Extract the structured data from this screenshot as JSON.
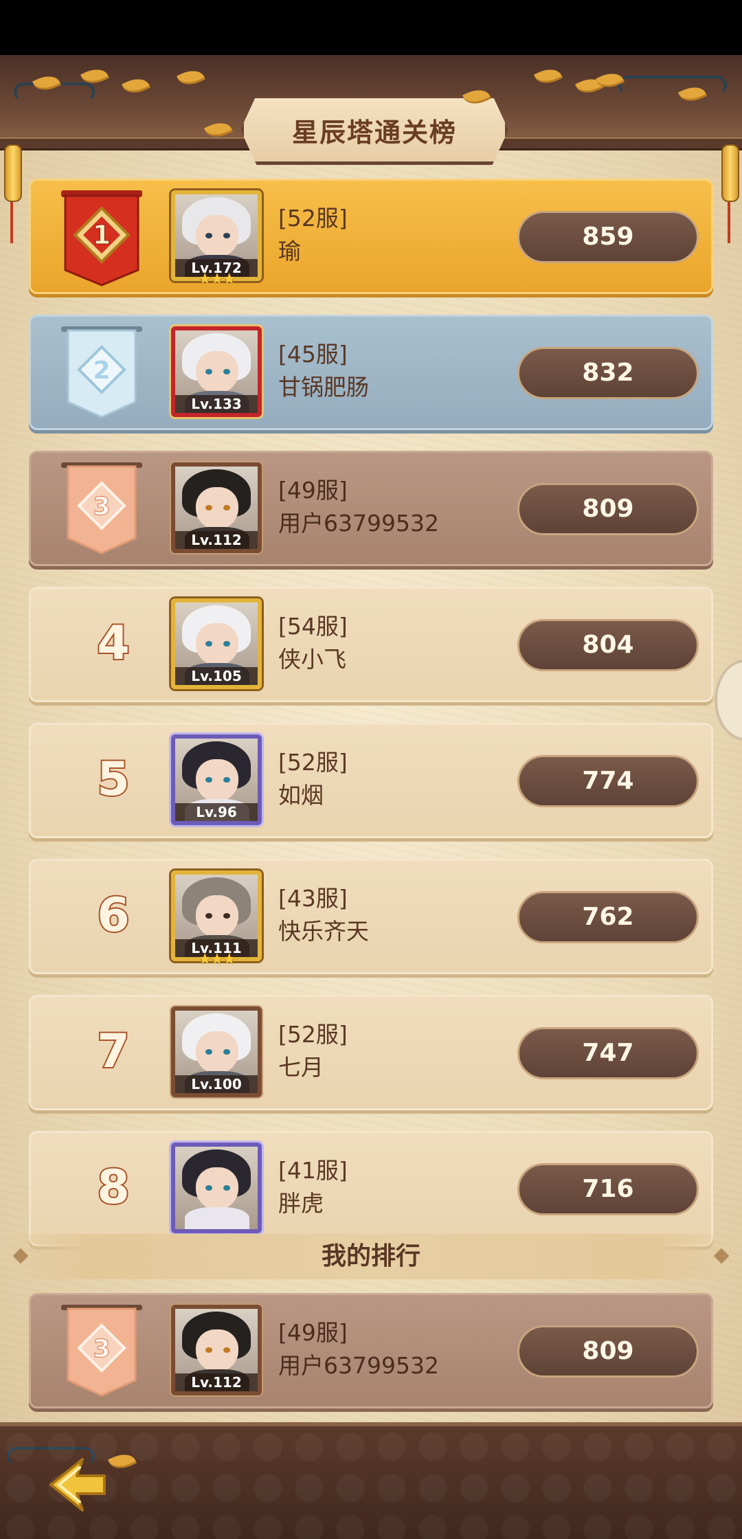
{
  "title": "星辰塔通关榜",
  "my_rank_header": "我的排行",
  "rows": [
    {
      "rank": "1",
      "server": "[52服]",
      "name": "瑜",
      "level": "Lv.172",
      "score": "859"
    },
    {
      "rank": "2",
      "server": "[45服]",
      "name": "甘锅肥肠",
      "level": "Lv.133",
      "score": "832"
    },
    {
      "rank": "3",
      "server": "[49服]",
      "name": "用户63799532",
      "level": "Lv.112",
      "score": "809"
    },
    {
      "rank": "4",
      "server": "[54服]",
      "name": "侠小飞",
      "level": "Lv.105",
      "score": "804"
    },
    {
      "rank": "5",
      "server": "[52服]",
      "name": "如烟",
      "level": "Lv.96",
      "score": "774"
    },
    {
      "rank": "6",
      "server": "[43服]",
      "name": "快乐齐天",
      "level": "Lv.111",
      "score": "762"
    },
    {
      "rank": "7",
      "server": "[52服]",
      "name": "七月",
      "level": "Lv.100",
      "score": "747"
    },
    {
      "rank": "8",
      "server": "[41服]",
      "name": "胖虎",
      "level": "",
      "score": "716"
    }
  ],
  "my_rank": {
    "rank": "3",
    "server": "[49服]",
    "name": "用户63799532",
    "level": "Lv.112",
    "score": "809"
  },
  "colors": {
    "gold_row": "#eaa52b",
    "silver_row": "#94acbd",
    "bronze_row": "#a8846f",
    "normal_row": "#e9d4af",
    "text_brown": "#5a3724"
  }
}
